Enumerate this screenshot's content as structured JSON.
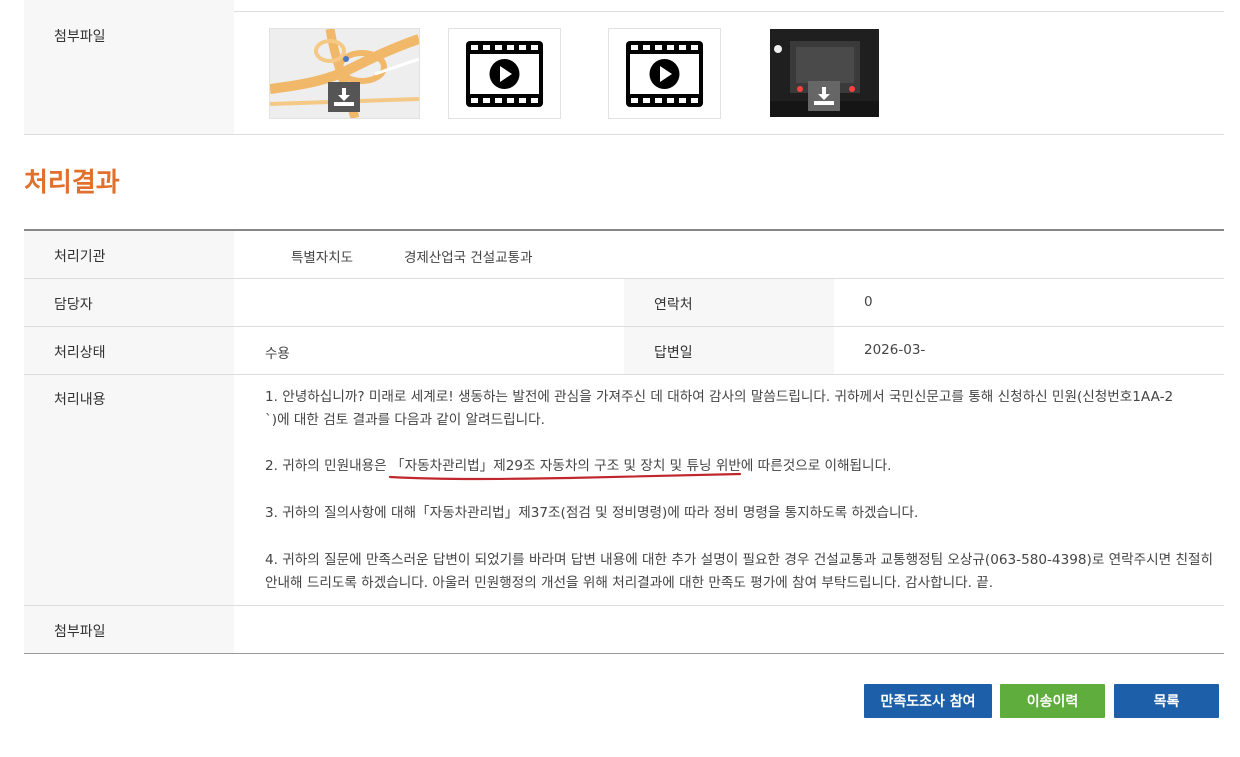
{
  "attachments": {
    "label": "첨부파일",
    "items": [
      {
        "kind": "map-image"
      },
      {
        "kind": "video"
      },
      {
        "kind": "video"
      },
      {
        "kind": "photo"
      }
    ]
  },
  "result": {
    "title": "처리결과",
    "agency_label": "처리기관",
    "agency_value_1": "특별자치도",
    "agency_value_2": "경제산업국 건설교통과",
    "manager_label": "담당자",
    "manager_value": "",
    "contact_label": "연락처",
    "contact_value": "0",
    "status_label": "처리상태",
    "status_value": "수용",
    "answer_date_label": "답변일",
    "answer_date_value": "2026-03-",
    "content_label": "처리내용",
    "content": {
      "p1_line1": "1. 안녕하십니까? 미래로 세계로! 생동하는 발전에 관심을 가져주신 데 대하여 감사의 말씀드립니다. 귀하께서 국민신문고를 통해 신청하신 민원(신청번호1AA-2",
      "p1_line2": "`)에 대한 검토 결과를 다음과 같이 알려드립니다.",
      "p2_prefix": "2. 귀하의 민원내용은 ",
      "p2_underlined": "「자동차관리법」제29조 자동차의 구조 및 장치 및 튜닝 위반",
      "p2_suffix": "에 따른것으로 이해됩니다.",
      "p3": "3. 귀하의 질의사항에 대해「자동차관리법」제37조(점검 및 정비명령)에 따라 정비 명령을 통지하도록 하겠습니다.",
      "p4_line1": "4. 귀하의 질문에 만족스러운 답변이 되었기를 바라며 답변 내용에 대한 추가 설명이 필요한 경우 건설교통과 교통행정팀 오상규(063-580-4398)로 연락주시면 친절히",
      "p4_line2": "안내해 드리도록 하겠습니다. 아울러 민원행정의 개선을 위해 처리결과에 대한 만족도 평가에 참여 부탁드립니다. 감사합니다. 끝."
    },
    "attachment_label": "첨부파일"
  },
  "buttons": {
    "survey": "만족도조사 참여",
    "transfer_history": "이송이력",
    "list": "목록"
  },
  "colors": {
    "title_accent": "#e0702b",
    "survey_button": "#1d5fa8",
    "transfer_button": "#5fad3c",
    "list_button": "#1d5fa8",
    "underline": "#c0272d"
  }
}
